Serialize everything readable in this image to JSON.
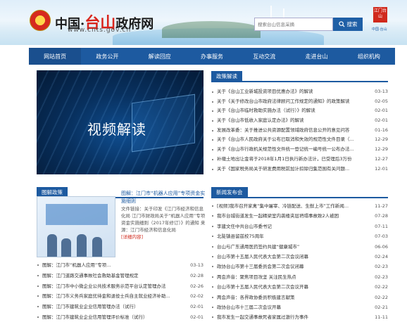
{
  "header": {
    "title_pre": "中国·",
    "title_red": "台山",
    "title_post": "政府网",
    "url": "www.cnts.gov.cn",
    "search_placeholder": "搜索台山信息采摘",
    "search_button": "搜索",
    "seal_text": "江门台山",
    "seal_caption": "中国·台山"
  },
  "nav": [
    "网站首页",
    "政务公开",
    "解读回应",
    "办事服务",
    "互动交流",
    "走进台山",
    "组织机构"
  ],
  "video": {
    "caption": "视频解读"
  },
  "policy": {
    "tab": "政策解读",
    "items": [
      {
        "t": "关于《台山工业新城投资项目优惠办法》的解读",
        "d": "03-13"
      },
      {
        "t": "关于《关于修改台山市政府法律顾问工作规定的通知》的政策解读",
        "d": "02-05"
      },
      {
        "t": "关于《台山市临时救助实施办法（试行）》的解读",
        "d": "02-01"
      },
      {
        "t": "关于《台山市低收入家庭认定办法》的解读",
        "d": "02-01"
      },
      {
        "t": "发展改革委：关于推进公共资源配置领域政府信息公开的意见问答",
        "d": "01-16"
      },
      {
        "t": "关于《台山市人民政府关于公布已取消和失效的规范性文件目录（...",
        "d": "12-29"
      },
      {
        "t": "关于《台山市行政机关规范性文件统一登记统一编号统一公布办法...",
        "d": "12-29"
      },
      {
        "t": "补缴土地出让金将于2018年1月1日执行新办法计，已受理后3万份",
        "d": "12-27"
      },
      {
        "t": "关于《国家税务局关于研发费用税前加计扣除归集范围有关问题...",
        "d": "12-01"
      }
    ]
  },
  "illustrated": {
    "tab": "图解政策",
    "feature_title": "图解：江门市“机器人应用”专项资金实施细则",
    "feature_body": "文件链接：关于印发《江门市经济和信息化局 江门市财政局关于“机器人应用”专项资金实施细则（2017年修订）》的通知 来源：江门市经济和信息化局",
    "feature_more": "[详细内容]",
    "items": [
      {
        "t": "图解：江门市“机器人应用”专项...",
        "d": "03-13"
      },
      {
        "t": "图解：江门道路交通事故社会救助基金管理规定",
        "d": "02-28"
      },
      {
        "t": "图解：江门市中小微企业公共技术服务示范平台认定管理办法",
        "d": "02-26"
      },
      {
        "t": "图解：江门市义务兵家庭优待金和退役士兵自主就业经济补助...",
        "d": "02-02"
      },
      {
        "t": "图解：江门市建筑业企业信用管理办法（试行）",
        "d": "02-01"
      },
      {
        "t": "图解：江门市建筑业企业信用管理评价标准（试行）",
        "d": "02-01"
      }
    ]
  },
  "news": {
    "tab": "新闻发布会",
    "items": [
      {
        "t": "[视频]我市召开家禽“集中屠宰、冷链配送、生鲜上市”工作新闻...",
        "d": "11-27"
      },
      {
        "t": "我市台城街道发生一起精梁室内袭楼夹层坍塌事故致2人被困",
        "d": "07-28"
      },
      {
        "t": "李建文任中共台山市委书记",
        "d": "07-11"
      },
      {
        "t": "北陡镇县留兹校75周年",
        "d": "07-03"
      },
      {
        "t": "台山与广东通用医药签约共建“健康城市”",
        "d": "06-06"
      },
      {
        "t": "台山市第十五届人民代表大会第二次会议闭幕",
        "d": "02-24"
      },
      {
        "t": "政协台山市第十三届委员会第二次会议闭幕",
        "d": "02-23"
      },
      {
        "t": "两会声音：聚焦项目攻坚 关注民生热点",
        "d": "02-23"
      },
      {
        "t": "台山市第十五届人民代表大会第二次会议开幕",
        "d": "02-22"
      },
      {
        "t": "两会声音：各界政协委员积极建言献策",
        "d": "02-22"
      },
      {
        "t": "政协台山市十三届二次会议开幕",
        "d": "02-21"
      },
      {
        "t": "我市发生一起交通事故死者家属过激行为事件",
        "d": "11-11"
      }
    ]
  },
  "colors": {
    "primary": "#1d5aa0",
    "accent": "#d9251c"
  }
}
